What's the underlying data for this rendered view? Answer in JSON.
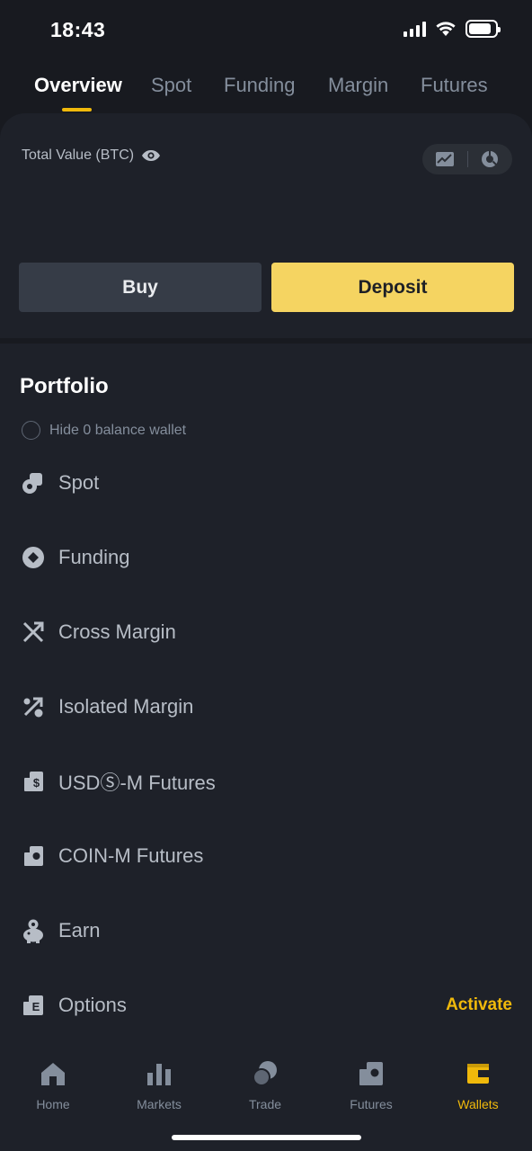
{
  "status": {
    "time": "18:43",
    "battery_level": 0.85
  },
  "top_tabs": [
    {
      "label": "Overview",
      "active": true
    },
    {
      "label": "Spot"
    },
    {
      "label": "Funding"
    },
    {
      "label": "Margin"
    },
    {
      "label": "Futures"
    }
  ],
  "overview": {
    "total_label": "Total Value (BTC)",
    "buy_label": "Buy",
    "deposit_label": "Deposit"
  },
  "portfolio": {
    "title": "Portfolio",
    "hide_zero_label": "Hide 0 balance wallet",
    "wallets": [
      {
        "label": "Spot",
        "icon": "spot-wallet-icon"
      },
      {
        "label": "Funding",
        "icon": "funding-wallet-icon"
      },
      {
        "label": "Cross Margin",
        "icon": "cross-margin-icon"
      },
      {
        "label": "Isolated Margin",
        "icon": "isolated-margin-icon"
      },
      {
        "label": "USDⓈ-M Futures",
        "icon": "usds-m-futures-icon"
      },
      {
        "label": "COIN-M Futures",
        "icon": "coin-m-futures-icon"
      },
      {
        "label": "Earn",
        "icon": "earn-icon"
      },
      {
        "label": "Options",
        "icon": "options-icon",
        "action": "Activate"
      }
    ]
  },
  "bottom_nav": [
    {
      "label": "Home",
      "icon": "home-icon"
    },
    {
      "label": "Markets",
      "icon": "markets-icon"
    },
    {
      "label": "Trade",
      "icon": "trade-icon"
    },
    {
      "label": "Futures",
      "icon": "futures-icon"
    },
    {
      "label": "Wallets",
      "icon": "wallet-icon",
      "active": true
    }
  ],
  "colors": {
    "accent": "#f0b90b",
    "deposit_button": "#f5d461",
    "background": "#1e2129"
  }
}
